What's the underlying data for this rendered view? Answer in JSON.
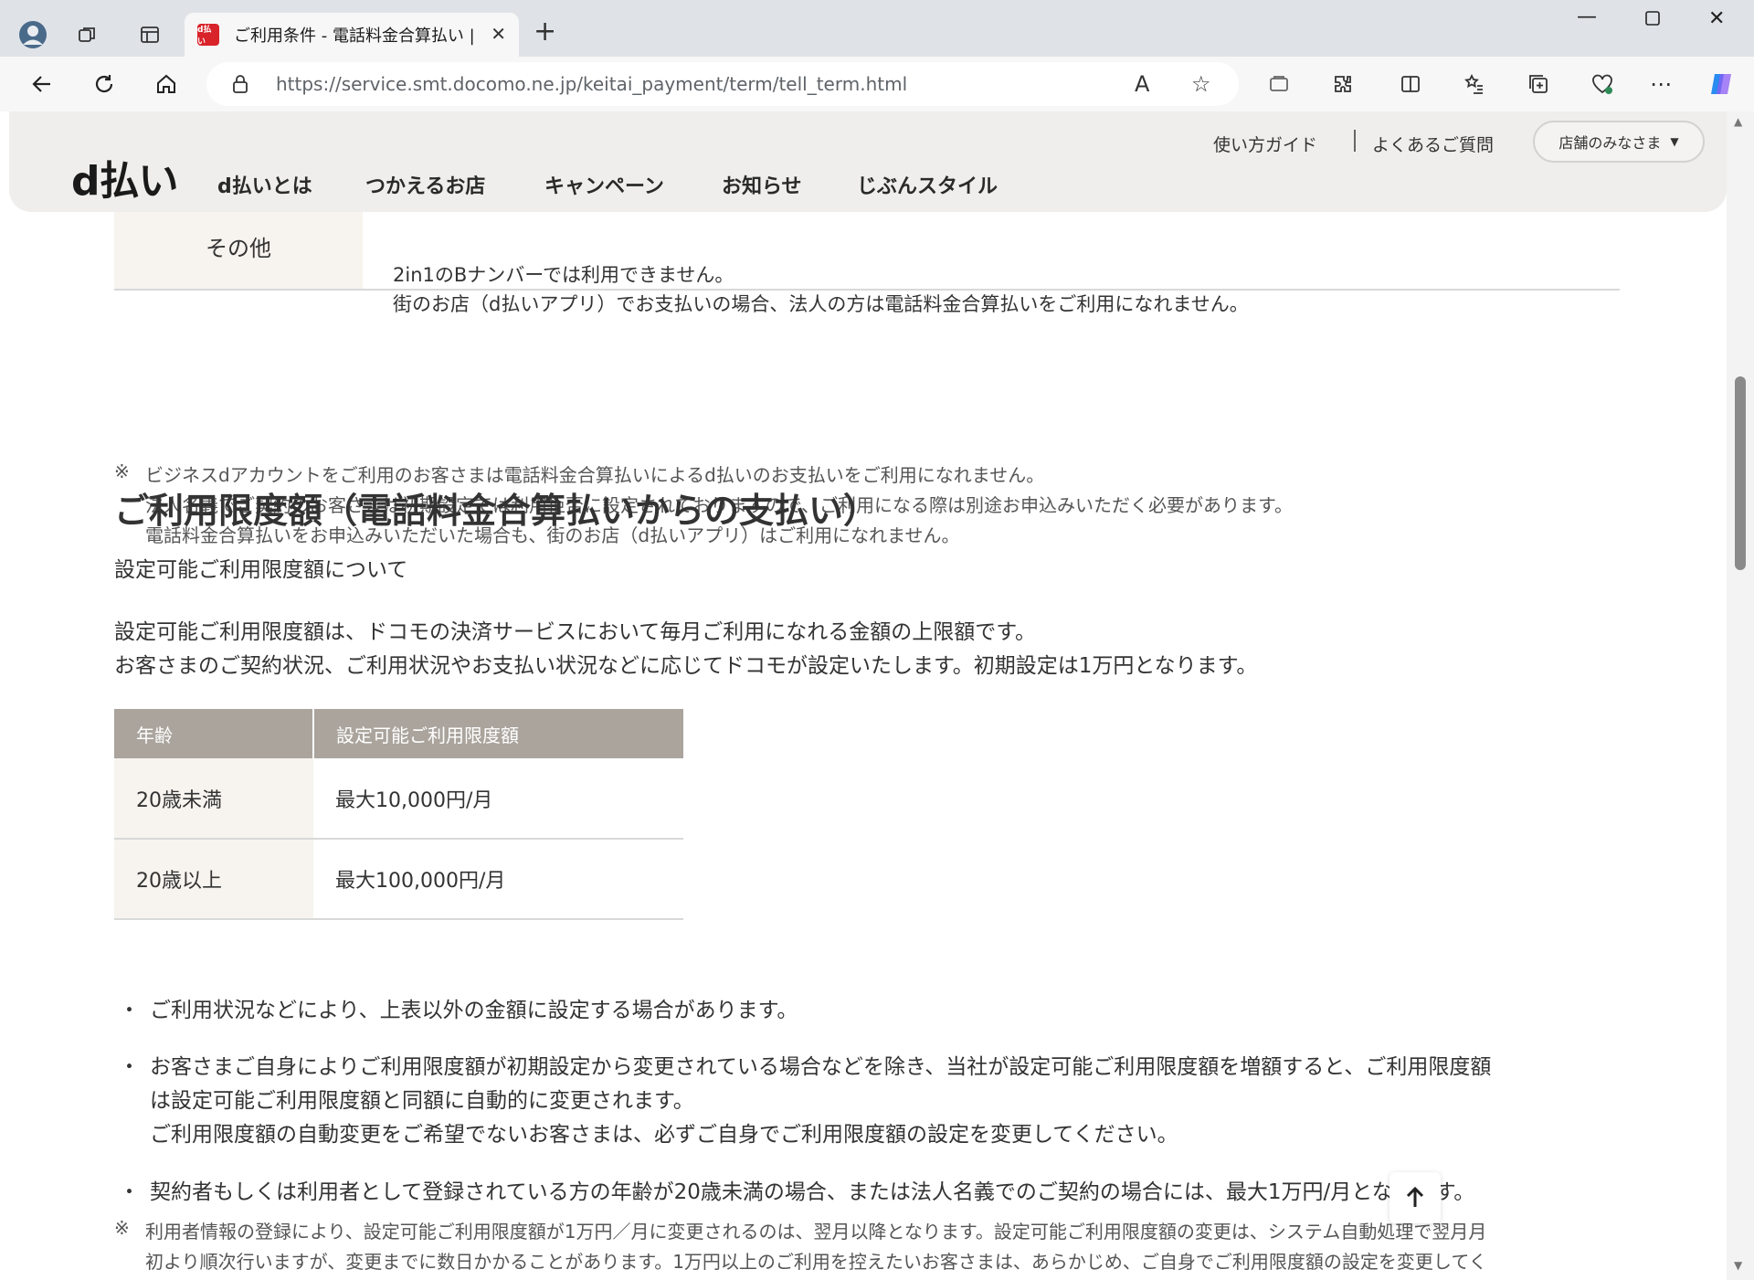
{
  "browser": {
    "tab_title": "ご利用条件 - 電話料金合算払い | d払い",
    "favicon_text": "d払い",
    "url": "https://service.smt.docomo.ne.jp/keitai_payment/term/tell_term.html"
  },
  "site_header": {
    "logo": "d払い",
    "nav": [
      "d払いとは",
      "つかえるお店",
      "キャンペーン",
      "お知らせ",
      "じぶんスタイル"
    ],
    "util_links": [
      "使い方ガイド",
      "よくあるご質問"
    ],
    "store_button": "店舗のみなさま",
    "store_arrow": "▼"
  },
  "other_row": {
    "label": "その他",
    "lines": [
      "2in1のBナンバーでは利用できません。",
      "街のお店（d払いアプリ）でお支払いの場合、法人の方は電話料金合算払いをご利用になれません。"
    ]
  },
  "note_block": {
    "mark": "※",
    "lines": [
      "ビジネスdアカウントをご利用のお客さまは電話料金合算払いによるd払いのお支払いをご利用になれません。",
      "法人名義でご契約のお客さまは初期設定では利用拒否に設定されておりますので、ご利用になる際は別途お申込みいただく必要があります。",
      "電話料金合算払いをお申込みいただいた場合も、街のお店（d払いアプリ）はご利用になれません。"
    ]
  },
  "section": {
    "title": "ご利用限度額（電話料金合算払いからの支払い）",
    "subtitle": "設定可能ご利用限度額について",
    "paragraph": [
      "設定可能ご利用限度額は、ドコモの決済サービスにおいて毎月ご利用になれる金額の上限額です。",
      "お客さまのご契約状況、ご利用状況やお支払い状況などに応じてドコモが設定いたします。初期設定は1万円となります。"
    ]
  },
  "limit_table": {
    "headers": [
      "年齢",
      "設定可能ご利用限度額"
    ],
    "rows": [
      {
        "age": "20歳未満",
        "limit": "最大10,000円/月"
      },
      {
        "age": "20歳以上",
        "limit": "最大100,000円/月"
      }
    ]
  },
  "bullets": {
    "mark": "・",
    "item1": "ご利用状況などにより、上表以外の金額に設定する場合があります。",
    "item2": [
      "お客さまご自身によりご利用限度額が初期設定から変更されている場合などを除き、当社が設定可能ご利用限度額を増額すると、ご利用限度額",
      "は設定可能ご利用限度額と同額に自動的に変更されます。",
      "ご利用限度額の自動変更をご希望でないお客さまは、必ずご自身でご利用限度額の設定を変更してください。"
    ],
    "item3": "契約者もしくは利用者として登録されている方の年齢が20歳未満の場合、または法人名義でのご契約の場合には、最大1万円/月となります。"
  },
  "bottom_note": {
    "mark": "※",
    "lines": [
      "利用者情報の登録により、設定可能ご利用限度額が1万円／月に変更されるのは、翌月以降となります。設定可能ご利用限度額の変更は、システム自動処理で翌月月",
      "初より順次行いますが、変更までに数日かかることがあります。1万円以上のご利用を控えたいお客さまは、あらかじめ、ご自身でご利用限度額の設定を変更してく"
    ]
  },
  "colors": {
    "table_header_bg": "#aaa49d",
    "row_head_bg": "#f7f4ef",
    "header_bg": "#efeeed",
    "favicon_red": "#d8232a"
  }
}
